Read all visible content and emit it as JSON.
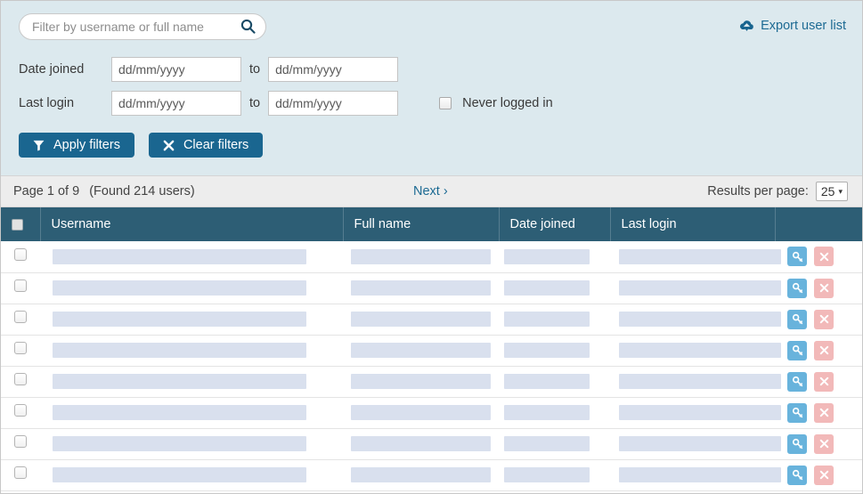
{
  "filters": {
    "search": {
      "value": "",
      "placeholder": "Filter by username or full name",
      "icon": "search-icon"
    },
    "export": {
      "label": "Export user list",
      "icon": "cloud-download-icon"
    },
    "date_joined": {
      "label": "Date joined",
      "from_placeholder": "dd/mm/yyyy",
      "from_value": "",
      "to_label": "to",
      "to_placeholder": "dd/mm/yyyy",
      "to_value": ""
    },
    "last_login": {
      "label": "Last login",
      "from_placeholder": "dd/mm/yyyy",
      "from_value": "",
      "to_label": "to",
      "to_placeholder": "dd/mm/yyyy",
      "to_value": ""
    },
    "never_logged_in": {
      "label": "Never logged in",
      "checked": false
    },
    "apply_button": {
      "label": "Apply filters",
      "icon": "funnel-icon"
    },
    "clear_button": {
      "label": "Clear filters",
      "icon": "x-icon"
    }
  },
  "pagination": {
    "page_label": "Page 1 of 9",
    "found_label": "(Found 214 users)",
    "next_label": "Next ›",
    "results_per_page_label": "Results per page:",
    "results_per_page_value": "25",
    "caret": "▾",
    "current_page": 1,
    "total_pages": 9,
    "total_users": 214
  },
  "table": {
    "select_all_checkbox": false,
    "columns": [
      {
        "key": "checkbox",
        "label": ""
      },
      {
        "key": "username",
        "label": "Username"
      },
      {
        "key": "fullname",
        "label": "Full name"
      },
      {
        "key": "joined",
        "label": "Date joined"
      },
      {
        "key": "login",
        "label": "Last login"
      },
      {
        "key": "actions",
        "label": ""
      }
    ],
    "rows": [
      {
        "checked": false,
        "username": "",
        "fullname": "",
        "joined": "",
        "login": "",
        "loading": true
      },
      {
        "checked": false,
        "username": "",
        "fullname": "",
        "joined": "",
        "login": "",
        "loading": true
      },
      {
        "checked": false,
        "username": "",
        "fullname": "",
        "joined": "",
        "login": "",
        "loading": true
      },
      {
        "checked": false,
        "username": "",
        "fullname": "",
        "joined": "",
        "login": "",
        "loading": true
      },
      {
        "checked": false,
        "username": "",
        "fullname": "",
        "joined": "",
        "login": "",
        "loading": true
      },
      {
        "checked": false,
        "username": "",
        "fullname": "",
        "joined": "",
        "login": "",
        "loading": true
      },
      {
        "checked": false,
        "username": "",
        "fullname": "",
        "joined": "",
        "login": "",
        "loading": true
      },
      {
        "checked": false,
        "username": "",
        "fullname": "",
        "joined": "",
        "login": "",
        "loading": true
      }
    ],
    "row_actions": {
      "login_as": {
        "icon": "key-icon",
        "title": "Log in as"
      },
      "delete": {
        "icon": "x-icon",
        "title": "Delete"
      }
    }
  },
  "colors": {
    "panel_bg": "#dce9ee",
    "header_bg": "#2d5e75",
    "button_blue": "#1a6690",
    "link_blue": "#1c6a93",
    "pagebar_bg": "#ededed",
    "placeholder_bar": "#d9e0ee",
    "action_login_bg": "#68b3dc",
    "action_delete_bg": "#f2b9b9"
  }
}
